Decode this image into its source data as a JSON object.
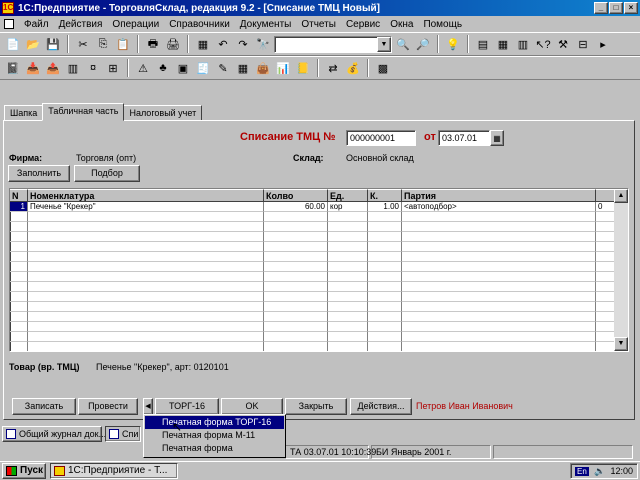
{
  "window": {
    "title": "1С:Предприятие - ТорговляСклад, редакция 9.2 - [Списание ТМЦ Новый]"
  },
  "menu": [
    "Файл",
    "Действия",
    "Операции",
    "Справочники",
    "Документы",
    "Отчеты",
    "Сервис",
    "Окна",
    "Помощь"
  ],
  "tabs": {
    "shapka": "Шапка",
    "table": "Табличная часть",
    "tax": "Налоговый учет"
  },
  "document": {
    "title": "Списание ТМЦ №",
    "number": "000000001",
    "date_label": "от",
    "date": "03.07.01",
    "firm_label": "Фирма:",
    "firm_value": "Торговля (опт)",
    "warehouse_label": "Склад:",
    "warehouse_value": "Основной склад"
  },
  "buttons": {
    "fill": "Заполнить",
    "select": "Подбор",
    "write": "Записать",
    "post": "Провести",
    "torg16": "ТОРГ-16",
    "ok": "OK",
    "close": "Закрыть",
    "actions": "Действия..."
  },
  "grid": {
    "columns": [
      "N",
      "Номенклатура",
      "Колво",
      "Ед.",
      "К.",
      "Партия",
      ""
    ],
    "rows": [
      {
        "n": "1",
        "item": "Печенье \"Крекер\"",
        "qty": "60.00",
        "unit": "кор",
        "coef": "1.00",
        "party": "<автоподбор>",
        "extra": "0"
      }
    ]
  },
  "goods_info": {
    "label": "Товар (вр. ТМЦ)",
    "value": "Печенье \"Крекер\", арт: 0120101"
  },
  "responsible": "Петров Иван Иванович",
  "print_menu": [
    "Печатная форма ТОРГ-16",
    "Печатная форма М-11",
    "Печатная форма"
  ],
  "mdi_tasks": [
    "Общий журнал док...",
    "Спи"
  ],
  "status": [
    "ТА 03.07.01 10:10:39",
    "БИ Январь 2001 г."
  ],
  "taskbar": {
    "start": "Пуск",
    "task": "1С:Предприятие - Т...",
    "lang": "En",
    "clock": "12:00"
  }
}
